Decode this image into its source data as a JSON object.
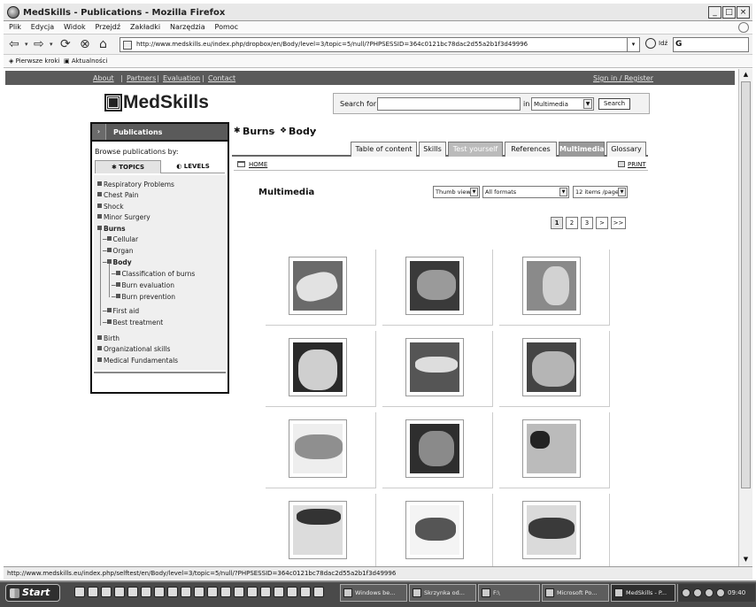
{
  "window": {
    "title": "MedSkills - Publications - Mozilla Firefox"
  },
  "menu": [
    "Plik",
    "Edycja",
    "Widok",
    "Przejdź",
    "Zakładki",
    "Narzędzia",
    "Pomoc"
  ],
  "address": {
    "url": "http://www.medskills.eu/index.php/dropbox/en/Body/level=3/topic=5/null/?PHPSESSID=364c0121bc78dac2d55a2b1f3d49996",
    "go_label": "Idź"
  },
  "bookmarks": [
    "Pierwsze kroki",
    "Aktualności"
  ],
  "site_nav": {
    "links": [
      "About",
      "Partners",
      "Evaluation",
      "Contact"
    ],
    "signin": "Sign in / Register"
  },
  "logo": {
    "text": "MedSkills"
  },
  "search": {
    "label_for": "Search for",
    "label_in": "in",
    "query": "",
    "scope": "Multimedia",
    "button": "Search"
  },
  "sidebar": {
    "title": "Publications",
    "browse_label": "Browse publications by:",
    "tabs": [
      "TOPICS",
      "LEVELS"
    ],
    "tree": [
      {
        "label": "Respiratory Problems"
      },
      {
        "label": "Chest Pain"
      },
      {
        "label": "Shock"
      },
      {
        "label": "Minor Surgery"
      },
      {
        "label": "Burns"
      },
      {
        "label": "Cellular"
      },
      {
        "label": "Organ"
      },
      {
        "label": "Body"
      },
      {
        "label": "Classification of burns"
      },
      {
        "label": "Burn evaluation"
      },
      {
        "label": "Burn prevention"
      },
      {
        "label": "First aid"
      },
      {
        "label": "Best treatment"
      },
      {
        "label": "Birth"
      },
      {
        "label": "Organizational skills"
      },
      {
        "label": "Medical Fundamentals"
      }
    ]
  },
  "breadcrumb": {
    "part1": "Burns",
    "sep": "-",
    "part2": "Body",
    "tail": "›"
  },
  "content_tabs": [
    "Table of content",
    "Skills",
    "Test yourself",
    "References",
    "Multimedia",
    "Glossary"
  ],
  "homebar": {
    "home": "HOME",
    "print": "PRINT"
  },
  "multimedia": {
    "title": "Multimedia",
    "filters": {
      "view": "Thumb view",
      "format": "All formats",
      "per_page": "12 items /page"
    },
    "pagination": [
      "1",
      "2",
      "3",
      ">",
      ">>"
    ],
    "current_page": "1",
    "thumbnail_count": 12
  },
  "status": {
    "text": "http://www.medskills.eu/index.php/selftest/en/Body/level=3/topic=5/null/?PHPSESSID=364c0121bc78dac2d55a2b1f3d49996"
  },
  "taskbar": {
    "start": "Start",
    "tasks": [
      "Windows be...",
      "Skrzynka od...",
      "F:\\",
      "Microsoft Po...",
      "MedSkills - P..."
    ],
    "clock": "09:40"
  }
}
